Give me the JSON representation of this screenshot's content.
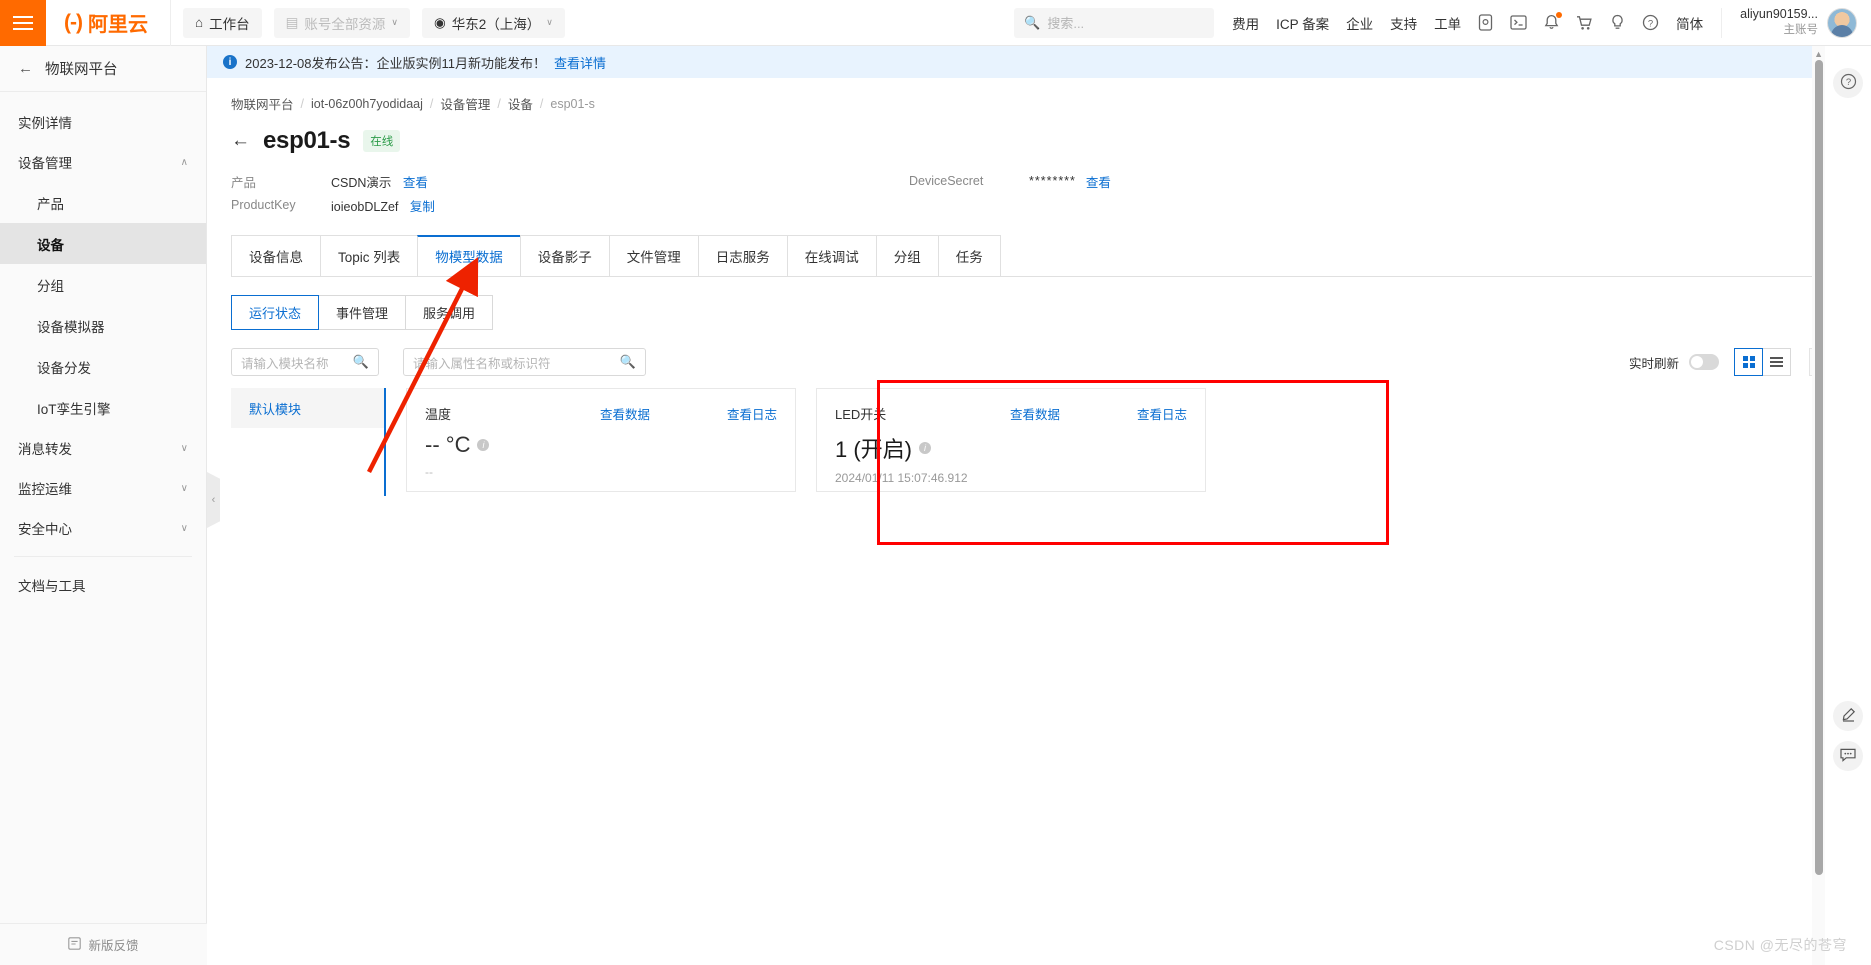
{
  "topbar": {
    "menu_icon": "hamburger-icon",
    "brand_mark": "(-)",
    "brand_text": "阿里云",
    "workbench": "工作台",
    "workbench_icon": "home-icon",
    "resources": "账号全部资源",
    "resources_icon": "grid-icon",
    "region": "华东2（上海）",
    "region_icon": "location-icon",
    "caret": "∨",
    "search_placeholder": "搜索...",
    "search_icon": "search-icon",
    "links": [
      "费用",
      "ICP 备案",
      "企业",
      "支持",
      "工单"
    ],
    "icons": [
      "mobile-icon",
      "terminal-icon",
      "bell-icon",
      "cart-icon",
      "bulb-icon",
      "help-icon"
    ],
    "lang": "简体",
    "account_name": "aliyun90159...",
    "account_sub": "主账号"
  },
  "sidebar": {
    "header": "物联网平台",
    "back_icon": "arrow-left-icon",
    "items": [
      {
        "label": "实例详情",
        "type": "plain"
      },
      {
        "label": "设备管理",
        "type": "group",
        "expanded": true,
        "chev": "∧"
      },
      {
        "label": "产品",
        "type": "sub"
      },
      {
        "label": "设备",
        "type": "sub",
        "active": true
      },
      {
        "label": "分组",
        "type": "sub"
      },
      {
        "label": "设备模拟器",
        "type": "sub"
      },
      {
        "label": "设备分发",
        "type": "sub"
      },
      {
        "label": "IoT孪生引擎",
        "type": "sub"
      },
      {
        "label": "消息转发",
        "type": "group",
        "expanded": false,
        "chev": "∨"
      },
      {
        "label": "监控运维",
        "type": "group",
        "expanded": false,
        "chev": "∨"
      },
      {
        "label": "安全中心",
        "type": "group",
        "expanded": false,
        "chev": "∨"
      },
      {
        "label": "文档与工具",
        "type": "plain",
        "divider_before": true
      }
    ],
    "footer": "新版反馈",
    "footer_icon": "feedback-icon",
    "collapse_icon": "chevron-left-icon"
  },
  "notice": {
    "icon": "info-icon",
    "text": "2023-12-08发布公告：企业版实例11月新功能发布！",
    "link": "查看详情",
    "close_icon": "close-icon"
  },
  "breadcrumb": [
    "物联网平台",
    "iot-06z00h7yodidaaj",
    "设备管理",
    "设备",
    "esp01-s"
  ],
  "page": {
    "back_icon": "arrow-left-icon",
    "title": "esp01-s",
    "status_badge": "在线",
    "meta": {
      "product_label": "产品",
      "product_value": "CSDN演示",
      "product_link": "查看",
      "productkey_label": "ProductKey",
      "productkey_value": "ioieobDLZef",
      "productkey_link": "复制",
      "secret_label": "DeviceSecret",
      "secret_value": "********",
      "secret_link": "查看"
    }
  },
  "tabs": [
    {
      "label": "设备信息",
      "active": false
    },
    {
      "label": "Topic 列表",
      "active": false
    },
    {
      "label": "物模型数据",
      "active": true
    },
    {
      "label": "设备影子",
      "active": false
    },
    {
      "label": "文件管理",
      "active": false
    },
    {
      "label": "日志服务",
      "active": false
    },
    {
      "label": "在线调试",
      "active": false
    },
    {
      "label": "分组",
      "active": false
    },
    {
      "label": "任务",
      "active": false
    }
  ],
  "subtabs": [
    {
      "label": "运行状态",
      "active": true
    },
    {
      "label": "事件管理",
      "active": false
    },
    {
      "label": "服务调用",
      "active": false
    }
  ],
  "filters": {
    "module_placeholder": "请输入模块名称",
    "property_placeholder": "请输入属性名称或标识符",
    "search_icon": "search-icon",
    "realtime_label": "实时刷新",
    "realtime_on": false,
    "grid_view_icon": "grid-view-icon",
    "list_view_icon": "list-view-icon",
    "help_icon": "question-icon",
    "accent": "#0a6ed1"
  },
  "modules": [
    {
      "label": "默认模块",
      "active": true
    }
  ],
  "cards": [
    {
      "name": "温度",
      "view_data": "查看数据",
      "view_log": "查看日志",
      "value": "-- °C",
      "info_icon": "info-icon",
      "timestamp": "--"
    },
    {
      "name": "LED开关",
      "view_data": "查看数据",
      "view_log": "查看日志",
      "value": "1 (开启)",
      "info_icon": "info-icon",
      "timestamp": "2024/01/11 15:07:46.912"
    }
  ],
  "annotation": {
    "box_color": "#ff0000",
    "arrow_color": "#ee2200"
  },
  "rail": {
    "help_icon": "question-circle-icon",
    "edit_icon": "pencil-icon",
    "chat_icon": "chat-icon"
  },
  "watermark": "CSDN @无尽的苍穹"
}
